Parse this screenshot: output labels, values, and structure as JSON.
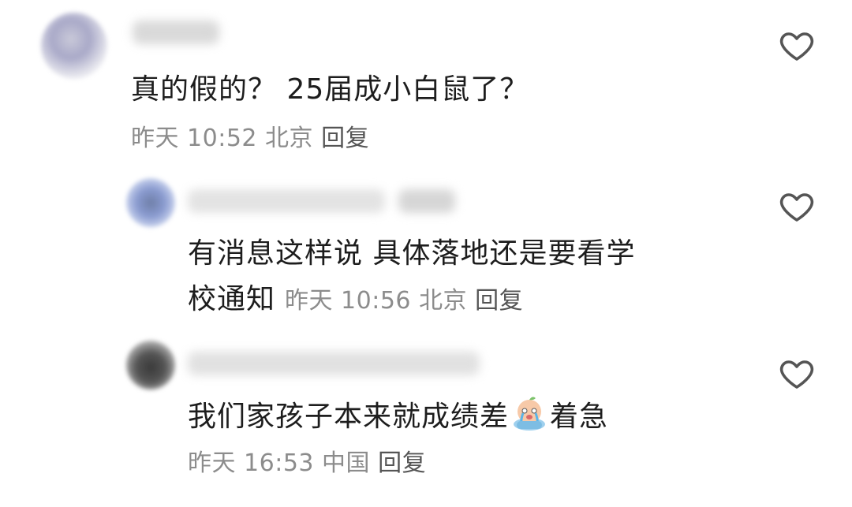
{
  "comments": [
    {
      "text": "真的假的？ 25届成小白鼠了？",
      "time": "昨天 10:52",
      "location": "北京",
      "reply_label": "回复"
    },
    {
      "text_line1": "有消息这样说 具体落地还是要看学",
      "text_line2": "校通知",
      "time": "昨天 10:56",
      "location": "北京",
      "reply_label": "回复"
    },
    {
      "text_before_emoji": "我们家孩子本来就成绩差",
      "emoji": "crying-emoji",
      "text_after_emoji": "着急",
      "time": "昨天 16:53",
      "location": "中国",
      "reply_label": "回复"
    }
  ],
  "icons": {
    "like": "heart-outline-icon"
  },
  "colors": {
    "text": "#1d1d1d",
    "meta": "#8c8c8c",
    "icon": "#555555"
  }
}
